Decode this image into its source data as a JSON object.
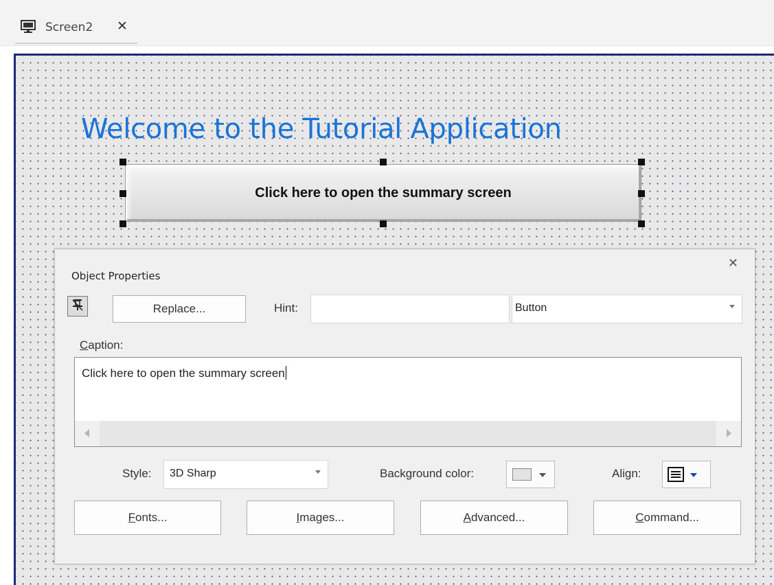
{
  "tab": {
    "label": "Screen2",
    "close": "✕"
  },
  "canvas": {
    "heading": "Welcome to the Tutorial Application",
    "button_caption": "Click here to open the summary screen"
  },
  "dialog": {
    "title": "Object Properties",
    "close": "✕",
    "replace_label": "Replace...",
    "hint_label": "Hint:",
    "hint_value": "",
    "type_value": "Button",
    "caption_label_accel": "C",
    "caption_label_rest": "aption:",
    "caption_value": "Click here to open the summary screen",
    "style_label": "Style:",
    "style_value": "3D Sharp",
    "bgcolor_label": "Background color:",
    "align_label": "Align:",
    "buttons": {
      "fonts": {
        "accel": "F",
        "rest": "onts..."
      },
      "images": {
        "accel": "I",
        "rest": "mages..."
      },
      "advanced": {
        "accel": "A",
        "rest": "dvanced..."
      },
      "command": {
        "accel": "C",
        "rest": "ommand..."
      }
    }
  },
  "colors": {
    "heading": "#1a73d6",
    "canvas_border": "#1c2a7a",
    "align_arrow": "#1a3fbf"
  }
}
